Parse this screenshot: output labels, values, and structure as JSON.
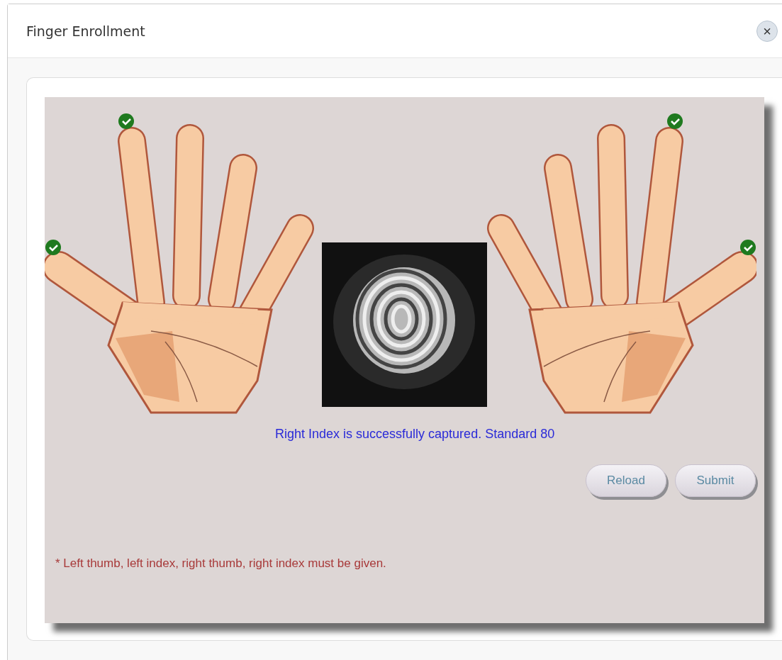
{
  "dialog": {
    "title": "Finger Enrollment",
    "close_label": "×"
  },
  "hands": [
    {
      "fingers": [
        {
          "captured": true
        },
        {
          "captured": true
        },
        {
          "captured": false
        },
        {
          "captured": false
        },
        {
          "captured": false
        }
      ]
    },
    {
      "fingers": [
        {
          "captured": true
        },
        {
          "captured": true
        },
        {
          "captured": false
        },
        {
          "captured": false
        },
        {
          "captured": false
        }
      ]
    }
  ],
  "status_message": "Right Index is successfully captured. Standard 80",
  "buttons": [
    "Reload",
    "Submit"
  ],
  "note": "* Left thumb, left index, right thumb, right index must be given."
}
